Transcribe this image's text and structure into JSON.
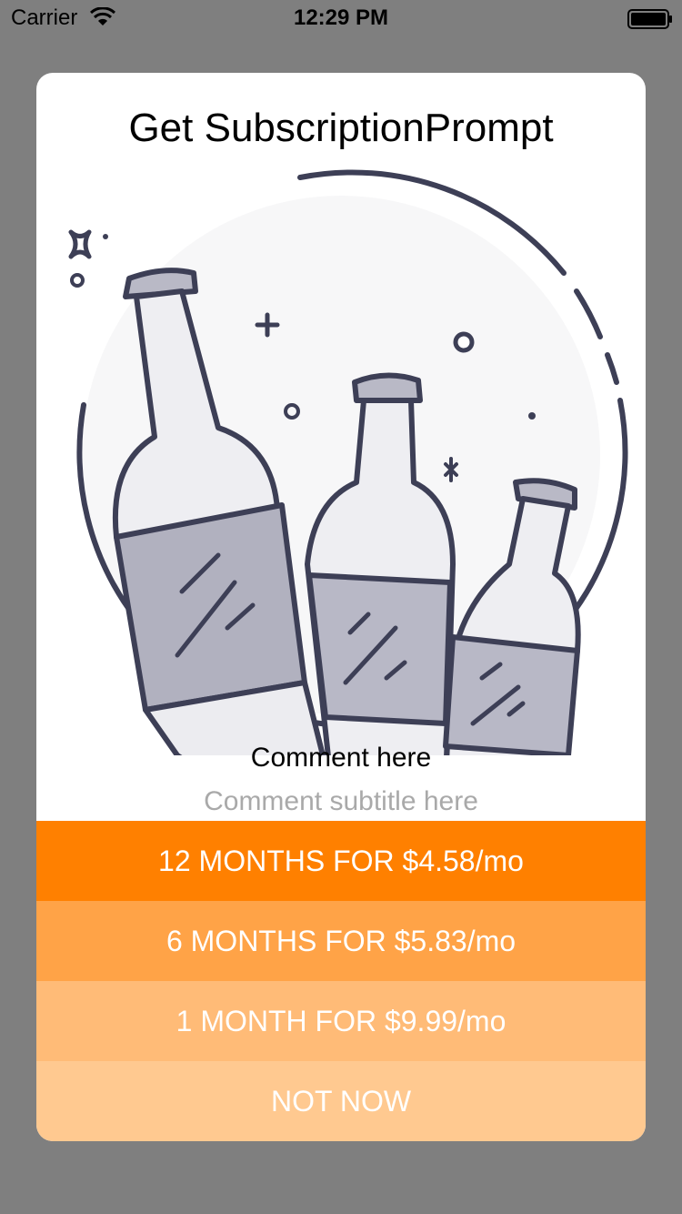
{
  "status_bar": {
    "carrier": "Carrier",
    "time": "12:29 PM"
  },
  "modal": {
    "title": "Get SubscriptionPrompt",
    "comment_title": "Comment here",
    "comment_subtitle": "Comment subtitle here",
    "options": [
      {
        "label": "12 MONTHS FOR $4.58/mo",
        "color": "#ff8000"
      },
      {
        "label": "6 MONTHS FOR $5.83/mo",
        "color": "#ffa347"
      },
      {
        "label": "1 MONTH FOR $9.99/mo",
        "color": "#ffbb77"
      }
    ],
    "dismiss_label": "NOT NOW",
    "dismiss_color": "#ffc990"
  },
  "illustration": {
    "icon": "wine-bottles-illustration",
    "line_color": "#3d3f56"
  },
  "colors": {
    "backdrop": "#7f7f7f",
    "modal_background": "#ffffff",
    "subtitle": "#a9a9a9"
  }
}
